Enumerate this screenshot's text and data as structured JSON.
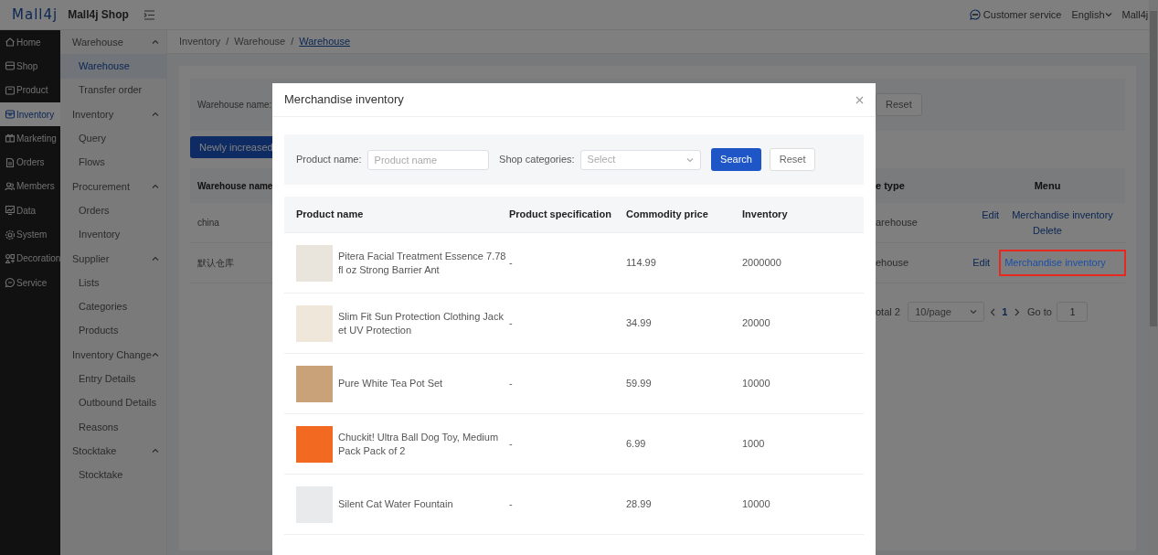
{
  "header": {
    "logo": "Mall4j",
    "shop_name": "Mall4j Shop",
    "service_link": "Customer service",
    "language": "English",
    "user": "Mall4j"
  },
  "sidebar": {
    "items": [
      {
        "label": "Home",
        "selected": false
      },
      {
        "label": "Shop",
        "selected": false
      },
      {
        "label": "Product",
        "selected": false
      },
      {
        "label": "Inventory",
        "selected": true
      },
      {
        "label": "Marketing",
        "selected": false
      },
      {
        "label": "Orders",
        "selected": false
      },
      {
        "label": "Members",
        "selected": false
      },
      {
        "label": "Data",
        "selected": false
      },
      {
        "label": "System",
        "selected": false
      },
      {
        "label": "Decoration",
        "selected": false
      },
      {
        "label": "Service",
        "selected": false
      }
    ]
  },
  "submenu": {
    "groups": [
      {
        "label": "Warehouse",
        "expanded": true,
        "children": [
          {
            "label": "Warehouse",
            "selected": true
          },
          {
            "label": "Transfer order",
            "selected": false
          }
        ]
      },
      {
        "label": "Inventory",
        "expanded": true,
        "children": [
          {
            "label": "Query",
            "selected": false
          },
          {
            "label": "Flows",
            "selected": false
          }
        ]
      },
      {
        "label": "Procurement",
        "expanded": true,
        "children": [
          {
            "label": "Orders",
            "selected": false
          },
          {
            "label": "Inventory",
            "selected": false
          }
        ]
      },
      {
        "label": "Supplier",
        "expanded": true,
        "children": [
          {
            "label": "Lists",
            "selected": false
          },
          {
            "label": "Categories",
            "selected": false
          },
          {
            "label": "Products",
            "selected": false
          }
        ]
      },
      {
        "label": "Inventory Change",
        "expanded": true,
        "children": [
          {
            "label": "Entry Details",
            "selected": false
          },
          {
            "label": "Outbound Details",
            "selected": false
          },
          {
            "label": "Reasons",
            "selected": false
          }
        ]
      },
      {
        "label": "Stocktake",
        "expanded": true,
        "children": [
          {
            "label": "Stocktake",
            "selected": false
          }
        ]
      }
    ]
  },
  "breadcrumb": {
    "separator": "/",
    "items": [
      "Inventory",
      "Warehouse",
      "Warehouse"
    ]
  },
  "page": {
    "filter_label": "Warehouse name:",
    "reset_button": "Reset",
    "add_button": "Newly increased",
    "table": {
      "columns": [
        "Warehouse name",
        "e type",
        "Menu"
      ],
      "rows": [
        {
          "name": "china",
          "type": "arehouse",
          "actions": [
            {
              "label": "Edit",
              "highlighted": false
            },
            {
              "label": "Merchandise inventory",
              "highlighted": false
            },
            {
              "label": "Delete",
              "highlighted": false
            }
          ]
        },
        {
          "name": "默认仓库",
          "type": "ehouse",
          "actions": [
            {
              "label": "Edit",
              "highlighted": false
            },
            {
              "label": "Merchandise inventory",
              "highlighted": true
            }
          ]
        }
      ]
    },
    "pagination": {
      "total": "otal 2",
      "page_size": "10/page",
      "pages": [
        {
          "label": "1",
          "selected": true
        }
      ],
      "goto_label": "Go to",
      "goto_value": "1"
    }
  },
  "modal": {
    "title": "Merchandise inventory",
    "product_name": {
      "label": "Product name:",
      "placeholder": "Product name"
    },
    "category": {
      "label": "Shop categories:",
      "placeholder": "Select"
    },
    "search_button": "Search",
    "reset_button": "Reset",
    "table": {
      "columns": [
        "Product name",
        "Product specification",
        "Commodity price",
        "Inventory"
      ],
      "rows": [
        {
          "name": "Pitera Facial Treatment Essence 7.78fl oz Strong Barrier Ant",
          "spec": "-",
          "price": "114.99",
          "inventory": "2000000"
        },
        {
          "name": "Slim Fit Sun Protection Clothing Jacket UV Protection",
          "spec": "-",
          "price": "34.99",
          "inventory": "20000"
        },
        {
          "name": "Pure White Tea Pot Set",
          "spec": "-",
          "price": "59.99",
          "inventory": "10000"
        },
        {
          "name": "Chuckit! Ultra Ball Dog Toy, Medium Pack Pack of 2",
          "spec": "-",
          "price": "6.99",
          "inventory": "1000"
        },
        {
          "name": "Silent Cat Water Fountain",
          "spec": "-",
          "price": "28.99",
          "inventory": "10000"
        }
      ]
    }
  }
}
